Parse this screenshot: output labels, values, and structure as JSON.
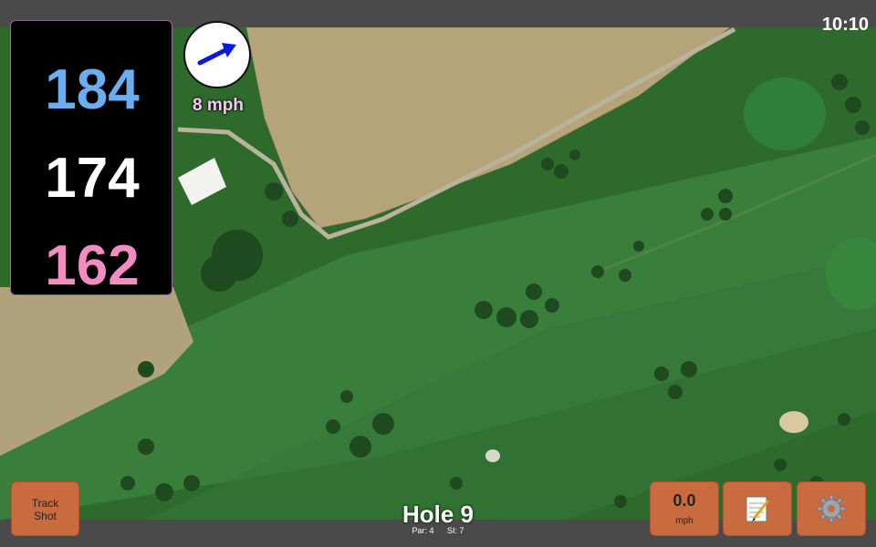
{
  "status_bar": {
    "time": "10:10"
  },
  "distances": {
    "back": "184",
    "middle": "174",
    "front": "162"
  },
  "wind": {
    "speed_label": "8 mph"
  },
  "buttons": {
    "track_shot_line1": "Track",
    "track_shot_line2": "Shot",
    "wind_value": "0.0",
    "wind_unit": "mph",
    "notes_icon": "notepad-icon",
    "settings_icon": "gear-icon"
  },
  "hole": {
    "title": "Hole 9",
    "par": "Par: 4",
    "si": "SI: 7"
  },
  "colors": {
    "distance_back": "#6aaef0",
    "distance_middle": "#ffffff",
    "distance_front": "#f48cc2",
    "button": "#c96b3f",
    "wind_arrow": "#0a18e0"
  }
}
